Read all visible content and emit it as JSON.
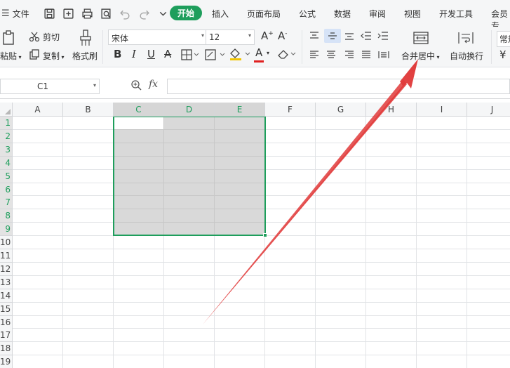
{
  "menubar": {
    "file_label": "文件",
    "tabs": [
      {
        "label": "开始",
        "active": true
      },
      {
        "label": "插入"
      },
      {
        "label": "页面布局"
      },
      {
        "label": "公式"
      },
      {
        "label": "数据"
      },
      {
        "label": "审阅"
      },
      {
        "label": "视图"
      },
      {
        "label": "开发工具"
      },
      {
        "label": "会员专"
      }
    ]
  },
  "ribbon": {
    "paste_label": "粘贴",
    "cut_label": "剪切",
    "copy_label": "复制",
    "format_painter_label": "格式刷",
    "font_name": "宋体",
    "font_size": "12",
    "bold": "B",
    "italic": "I",
    "underline": "U",
    "strike": "A",
    "font_color": "A",
    "merge_center_label": "合并居中",
    "wrap_text_label": "自动换行",
    "number_format": "常规",
    "currency": "¥"
  },
  "formula_bar": {
    "name_box": "C1",
    "fx_label": "fx",
    "formula": ""
  },
  "grid": {
    "columns": [
      "A",
      "B",
      "C",
      "D",
      "E",
      "F",
      "G",
      "H",
      "I",
      "J"
    ],
    "rows": [
      "1",
      "2",
      "3",
      "4",
      "5",
      "6",
      "7",
      "8",
      "9",
      "10",
      "11",
      "12",
      "13",
      "14",
      "15",
      "16",
      "17",
      "18",
      "19"
    ],
    "selected_columns": [
      "C",
      "D",
      "E"
    ],
    "selected_rows": [
      "1",
      "2",
      "3",
      "4",
      "5",
      "6",
      "7",
      "8",
      "9"
    ]
  },
  "colors": {
    "accent": "#1e9e5c",
    "annotation_arrow": "#e03a3a",
    "selection_fill": "#d9d9d9"
  }
}
